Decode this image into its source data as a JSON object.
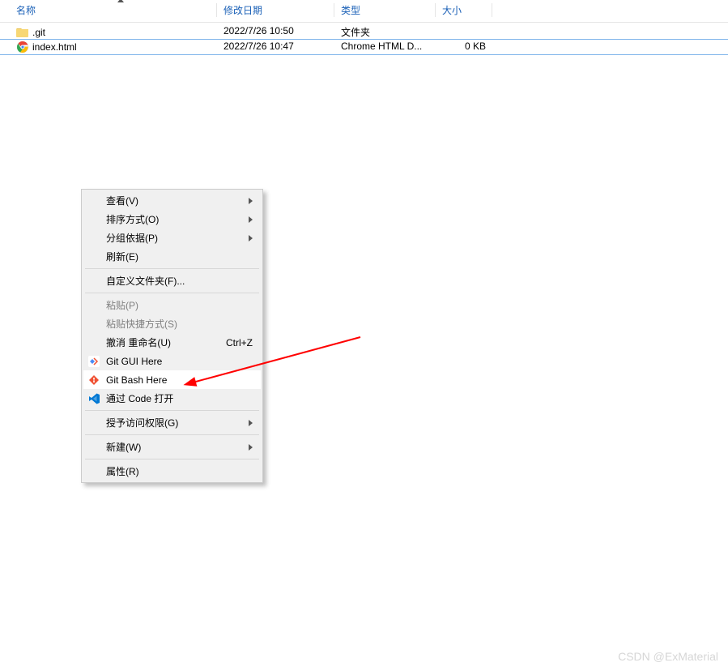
{
  "header": {
    "name": "名称",
    "date": "修改日期",
    "type": "类型",
    "size": "大小"
  },
  "files": [
    {
      "icon": "folder",
      "name": ".git",
      "date": "2022/7/26 10:50",
      "type": "文件夹",
      "size": "",
      "selected": false
    },
    {
      "icon": "chrome",
      "name": "index.html",
      "date": "2022/7/26 10:47",
      "type": "Chrome HTML D...",
      "size": "0 KB",
      "selected": true
    }
  ],
  "context_menu": [
    {
      "label": "查看(V)",
      "submenu": true
    },
    {
      "label": "排序方式(O)",
      "submenu": true
    },
    {
      "label": "分组依据(P)",
      "submenu": true
    },
    {
      "label": "刷新(E)"
    },
    {
      "sep": true
    },
    {
      "label": "自定义文件夹(F)..."
    },
    {
      "sep": true
    },
    {
      "label": "粘贴(P)",
      "disabled": true
    },
    {
      "label": "粘贴快捷方式(S)",
      "disabled": true
    },
    {
      "label": "撤消 重命名(U)",
      "shortcut": "Ctrl+Z"
    },
    {
      "icon": "git-gui",
      "label": "Git GUI Here"
    },
    {
      "icon": "git-bash",
      "label": "Git Bash Here",
      "highlight": true
    },
    {
      "icon": "vscode",
      "label": "通过 Code 打开"
    },
    {
      "sep": true
    },
    {
      "label": "授予访问权限(G)",
      "submenu": true
    },
    {
      "sep": true
    },
    {
      "label": "新建(W)",
      "submenu": true
    },
    {
      "sep": true
    },
    {
      "label": "属性(R)"
    }
  ],
  "watermark": "CSDN @ExMaterial"
}
